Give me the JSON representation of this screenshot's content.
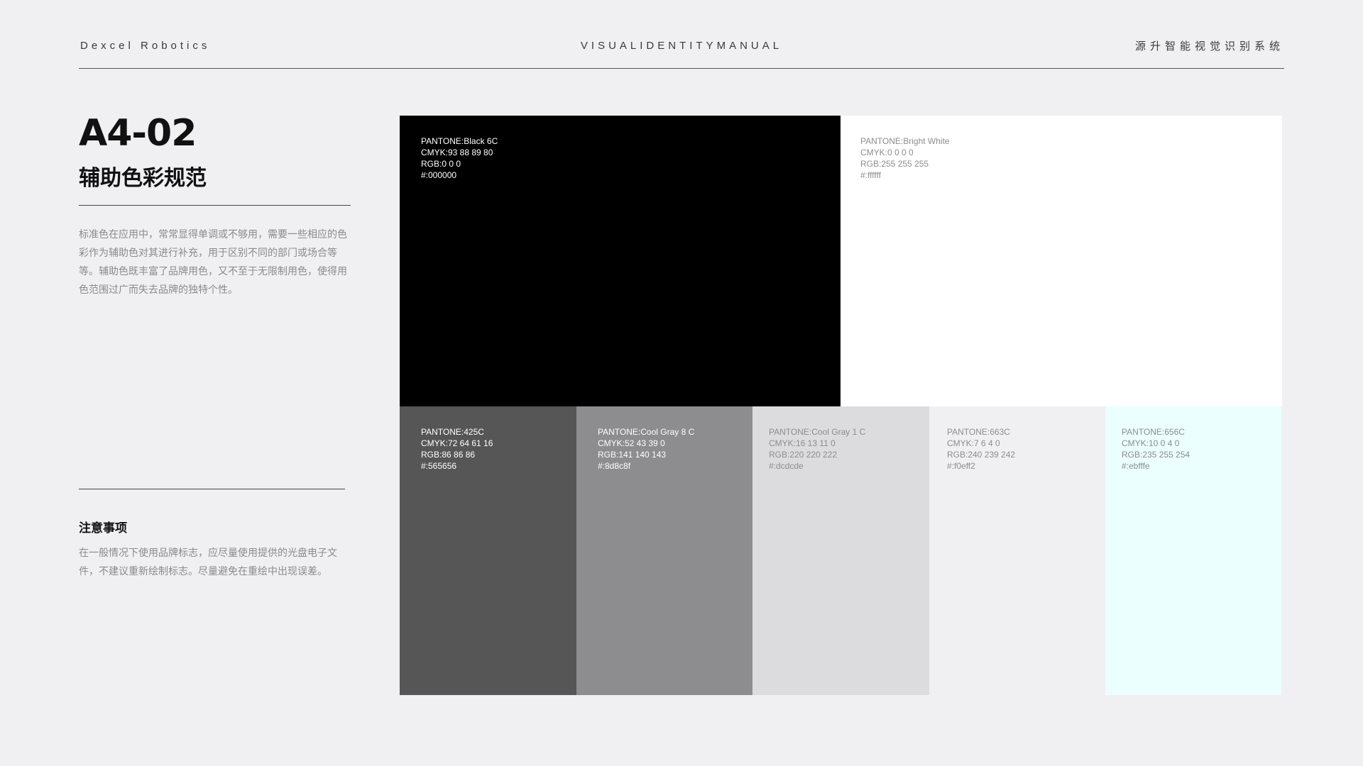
{
  "header": {
    "brand": "Dexcel Robotics",
    "manual": "VISUALIDENTITYMANUAL",
    "system_cn": "源升智能视觉识别系统"
  },
  "section": {
    "code": "A4-02",
    "title": "辅助色彩规范",
    "description": "标准色在应用中，常常显得单调或不够用，需要一些相应的色彩作为辅助色对其进行补充，用于区别不同的部门或场合等等。辅助色既丰富了品牌用色，又不至于无限制用色，使得用色范围过广而失去品牌的独特个性。"
  },
  "notes": {
    "title": "注意事项",
    "body": "在一般情况下使用品牌标志，应尽量使用提供的光盘电子文件，不建议重新绘制标志。尽量避免在重绘中出现误差。"
  },
  "swatches": {
    "black": {
      "pantone": "PANTONE:Black 6C",
      "cmyk": "CMYK:93 88 89 80",
      "rgb": "RGB:0 0 0",
      "hex": "#:000000",
      "color": "#000000",
      "text_color": "#ffffff"
    },
    "white": {
      "pantone": "PANTONE:Bright White",
      "cmyk": "CMYK:0 0 0 0",
      "rgb": "RGB:255 255 255",
      "hex": "#:ffffff",
      "color": "#ffffff",
      "text_color": "#8d8c8f"
    },
    "c425": {
      "pantone": "PANTONE:425C",
      "cmyk": "CMYK:72 64 61 16",
      "rgb": "RGB:86 86 86",
      "hex": "#:565656",
      "color": "#565656",
      "text_color": "#ffffff"
    },
    "coolgray8": {
      "pantone": "PANTONE:Cool Gray 8 C",
      "cmyk": "CMYK:52 43 39 0",
      "rgb": "RGB:141 140 143",
      "hex": "#:8d8c8f",
      "color": "#8d8c8f",
      "text_color": "#ffffff"
    },
    "coolgray1": {
      "pantone": "PANTONE:Cool Gray 1 C",
      "cmyk": "CMYK:16 13 11 0",
      "rgb": "RGB:220 220 222",
      "hex": "#:dcdcde",
      "color": "#dcdcde",
      "text_color": "#8d8c8f"
    },
    "c663": {
      "pantone": "PANTONE:663C",
      "cmyk": "CMYK:7 6 4 0",
      "rgb": "RGB:240 239 242",
      "hex": "#:f0eff2",
      "color": "#f0eff2",
      "text_color": "#8d8c8f"
    },
    "c656": {
      "pantone": "PANTONE:656C",
      "cmyk": "CMYK:10 0 4 0",
      "rgb": "RGB:235 255 254",
      "hex": "#:ebfffe",
      "color": "#ebfffe",
      "text_color": "#8d8c8f"
    }
  }
}
